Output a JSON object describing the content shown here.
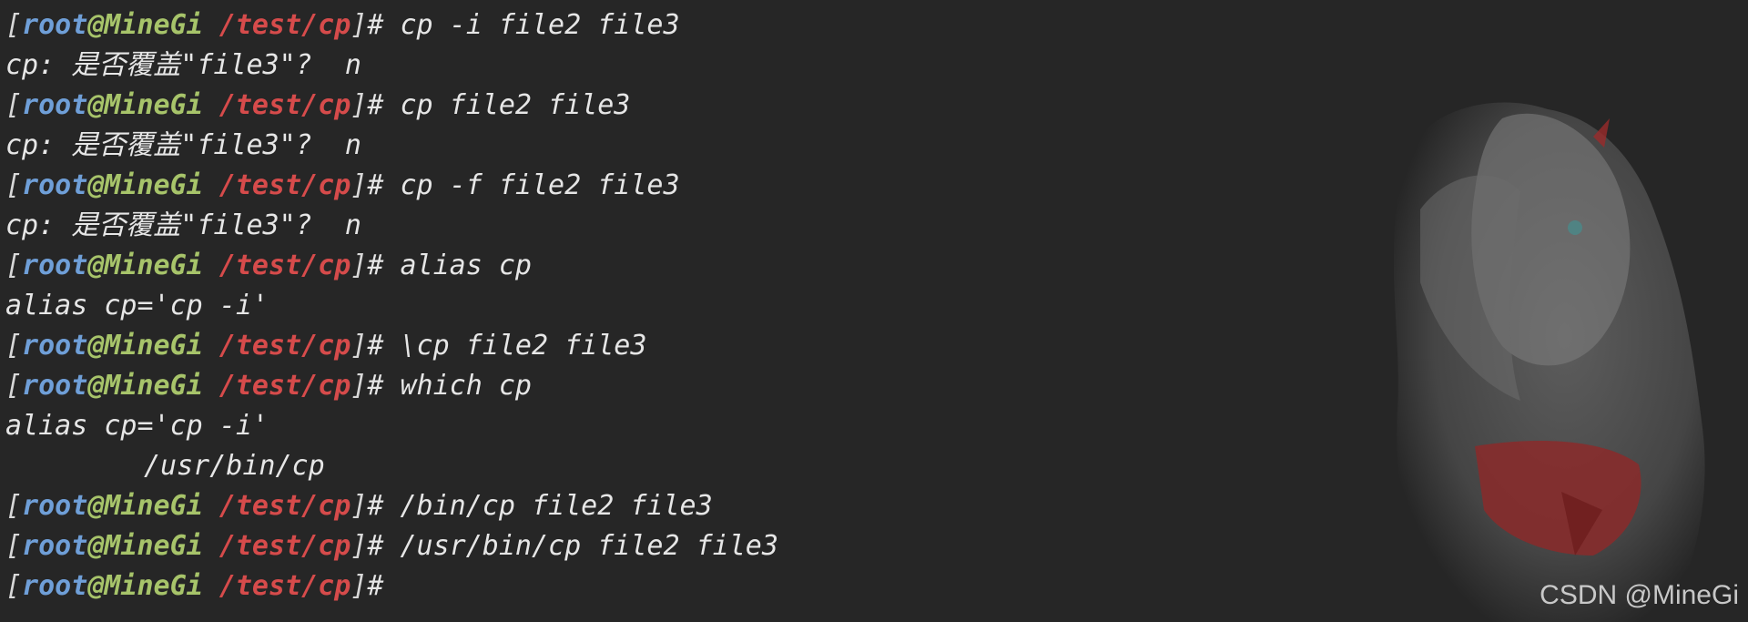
{
  "prompt": {
    "open_bracket": "[",
    "user": "root",
    "at": "@",
    "host": "MineGi",
    "path": "/test/cp",
    "close_bracket": "]",
    "symbol": "#"
  },
  "lines": [
    {
      "type": "cmd",
      "text": " cp -i file2 file3"
    },
    {
      "type": "out",
      "text": "cp: 是否覆盖\"file3\"?  n"
    },
    {
      "type": "cmd",
      "text": " cp file2 file3"
    },
    {
      "type": "out",
      "text": "cp: 是否覆盖\"file3\"?  n"
    },
    {
      "type": "cmd",
      "text": " cp -f file2 file3"
    },
    {
      "type": "out",
      "text": "cp: 是否覆盖\"file3\"?  n"
    },
    {
      "type": "cmd",
      "text": " alias cp"
    },
    {
      "type": "out",
      "text": "alias cp='cp -i'"
    },
    {
      "type": "cmd",
      "text": " \\cp file2 file3"
    },
    {
      "type": "cmd",
      "text": " which cp"
    },
    {
      "type": "out",
      "text": "alias cp='cp -i'"
    },
    {
      "type": "out-indent",
      "text": "/usr/bin/cp"
    },
    {
      "type": "cmd",
      "text": " /bin/cp file2 file3"
    },
    {
      "type": "cmd",
      "text": " /usr/bin/cp file2 file3"
    },
    {
      "type": "cmd",
      "text": ""
    }
  ],
  "watermark": "CSDN @MineGi"
}
